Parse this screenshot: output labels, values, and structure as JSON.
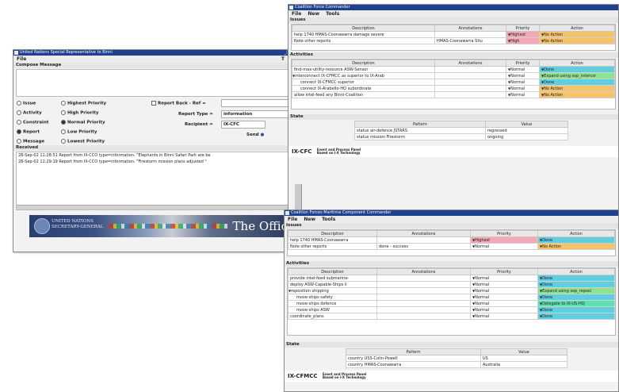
{
  "un": {
    "title": "United Nations Special Representative to Binni",
    "menu": [
      "File"
    ],
    "compose_label": "Compose Message",
    "radios_left": [
      "Issue",
      "Activity",
      "Constraint",
      "Report",
      "Message"
    ],
    "radios_right": [
      "Highest Priority",
      "High Priority",
      "Normal Priority",
      "Low Priority",
      "Lowest Priority"
    ],
    "selected_type": "Report",
    "selected_priority": "Normal Priority",
    "report_back_label": "Report Back - Ref =",
    "report_type_label": "Report Type =",
    "report_type_value": "information",
    "recipient_label": "Recipient =",
    "recipient_value": "IX-CFC",
    "send_label": "Send",
    "received_label": "Received",
    "received_lines": [
      "28-Sep-02 11:28:51 Report from IX-CCO type=information: \"Elephants in Binni Safari Park are be",
      "28-Sep-02 11:29:19 Report from IX-CCO type=information: \"Firestorm mission plans adjusted \""
    ],
    "banner_left": [
      "UNITED NATIONS",
      "SECRETARY-GENERAL"
    ],
    "banner_right": "The Offic"
  },
  "cfc": {
    "title": "Coalition Force Commander",
    "menu": [
      "File",
      "New",
      "Tools"
    ],
    "issues_label": "Issues",
    "activities_label": "Activities",
    "state_label": "State",
    "columns": [
      "Description",
      "Annotations",
      "Priority",
      "Action"
    ],
    "issues": [
      {
        "desc": "help 1740 HMAS-Coonawarra damage severe",
        "ann": "",
        "priority": "Highest",
        "action": "No Action"
      },
      {
        "desc": "Note other reports",
        "ann": "HMAS-Coonawarra Situ",
        "priority": "High",
        "action": "No Action"
      }
    ],
    "activities": [
      {
        "desc": "find-max-utility-resource ASW-Sensor",
        "ann": "",
        "priority": "Normal",
        "action": "Done",
        "tree": false,
        "indent": false
      },
      {
        "desc": "interconnect IX-CFMCC as superior to IX-Arab",
        "ann": "",
        "priority": "Normal",
        "action": "Expand using sop_intercor",
        "tree": true,
        "indent": false
      },
      {
        "desc": "connect IX-CFMCC superior",
        "ann": "",
        "priority": "Normal",
        "action": "Done",
        "tree": false,
        "indent": true
      },
      {
        "desc": "connect IX-Arabello-HQ subordinate",
        "ann": "",
        "priority": "Normal",
        "action": "No Action",
        "tree": false,
        "indent": true
      },
      {
        "desc": "allow intel-feed any Binni-Coalition",
        "ann": "",
        "priority": "Normal",
        "action": "No Action",
        "tree": false,
        "indent": false
      }
    ],
    "state_columns": [
      "Pattern",
      "Value"
    ],
    "state_rows": [
      {
        "pattern": "status air-defence JSTARS",
        "value": "regressed"
      },
      {
        "pattern": "status mission Firestorm",
        "value": "ongoing"
      }
    ],
    "logo_name": "IX-CFC",
    "logo_tag1": "Event and Process Panel",
    "logo_tag2": "Based on I-X Technology"
  },
  "cfmcc": {
    "title": "Coalition Forces Maritime Component Commander",
    "menu": [
      "File",
      "New",
      "Tools"
    ],
    "issues_label": "Issues",
    "activities_label": "Activities",
    "state_label": "State",
    "columns": [
      "Description",
      "Annotations",
      "Priority",
      "Action"
    ],
    "issues": [
      {
        "desc": "help 1740 HMAS-Coonawarra",
        "ann": "",
        "priority": "Highest",
        "action": "Done"
      },
      {
        "desc": "Note other reports",
        "ann": "done - success",
        "priority": "Normal",
        "action": "No Action"
      }
    ],
    "activities": [
      {
        "desc": "provide intel-feed submarine-",
        "ann": "",
        "priority": "Normal",
        "action": "Done",
        "tree": false,
        "indent": false
      },
      {
        "desc": "deploy ASW-Capable-Ships li",
        "ann": "",
        "priority": "Normal",
        "action": "Done",
        "tree": false,
        "indent": false
      },
      {
        "desc": "reposition shipping",
        "ann": "",
        "priority": "Normal",
        "action": "Expand using sop_reposi",
        "tree": true,
        "indent": false
      },
      {
        "desc": "move-ships safety",
        "ann": "",
        "priority": "Normal",
        "action": "Done",
        "tree": false,
        "indent": true
      },
      {
        "desc": "move-ships defence",
        "ann": "",
        "priority": "Normal",
        "action": "Delegate to IX-US-HQ",
        "tree": false,
        "indent": true
      },
      {
        "desc": "move-ships ASW",
        "ann": "",
        "priority": "Normal",
        "action": "Done",
        "tree": false,
        "indent": true
      },
      {
        "desc": "coordinate_plans",
        "ann": "",
        "priority": "Normal",
        "action": "Done",
        "tree": false,
        "indent": false
      }
    ],
    "state_columns": [
      "Pattern",
      "Value"
    ],
    "state_rows": [
      {
        "pattern": "country USS-Colin-Powell",
        "value": "US"
      },
      {
        "pattern": "country HMAS-Coonawarra",
        "value": "Australia"
      }
    ],
    "logo_name": "IX-CFMCC",
    "logo_tag1": "Event and Process Panel",
    "logo_tag2": "Based on I-X Technology"
  },
  "colors": {
    "title_bar": "#1f3f8f",
    "highest": "#f6a8b6",
    "no_action": "#f6c26a",
    "done": "#5fcfe0",
    "expand": "#8ee48e",
    "delegate": "#5fe0b0"
  }
}
